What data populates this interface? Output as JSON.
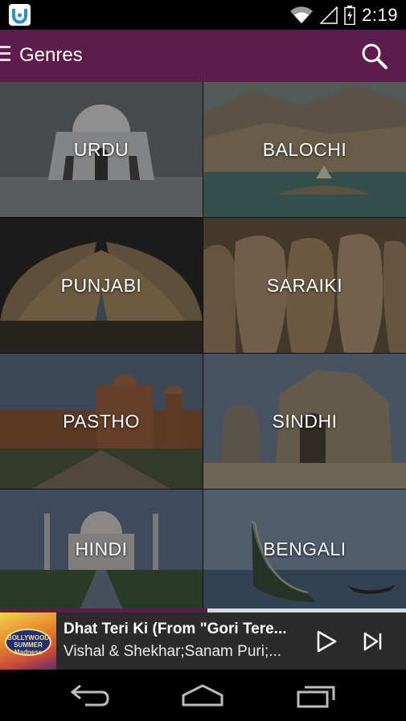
{
  "status_bar": {
    "time": "2:19",
    "icons": [
      "app-icon",
      "wifi-icon",
      "signal-icon",
      "battery-icon"
    ]
  },
  "action_bar": {
    "title": "Genres",
    "menu_icon": "hamburger-icon",
    "search_icon": "search-icon",
    "background_color": "#5e1c4d"
  },
  "genres": [
    {
      "label": "URDU"
    },
    {
      "label": "BALOCHI"
    },
    {
      "label": "PUNJABI"
    },
    {
      "label": "SARAIKI"
    },
    {
      "label": "PASTHO"
    },
    {
      "label": "SINDHI"
    },
    {
      "label": "HINDI"
    },
    {
      "label": "BENGALI"
    }
  ],
  "player": {
    "progress_fraction": 0.51,
    "album_badge": "BOLLYWOOD SUMMER Madness",
    "track_title": "Dhat Teri Ki (From \"Gori Tere...",
    "track_artist": "Vishal & Shekhar;Sanam Puri;...",
    "play_icon": "play-icon",
    "next_icon": "skip-next-icon"
  },
  "nav_bar": {
    "icons": [
      "back-icon",
      "home-icon",
      "recent-apps-icon"
    ]
  }
}
